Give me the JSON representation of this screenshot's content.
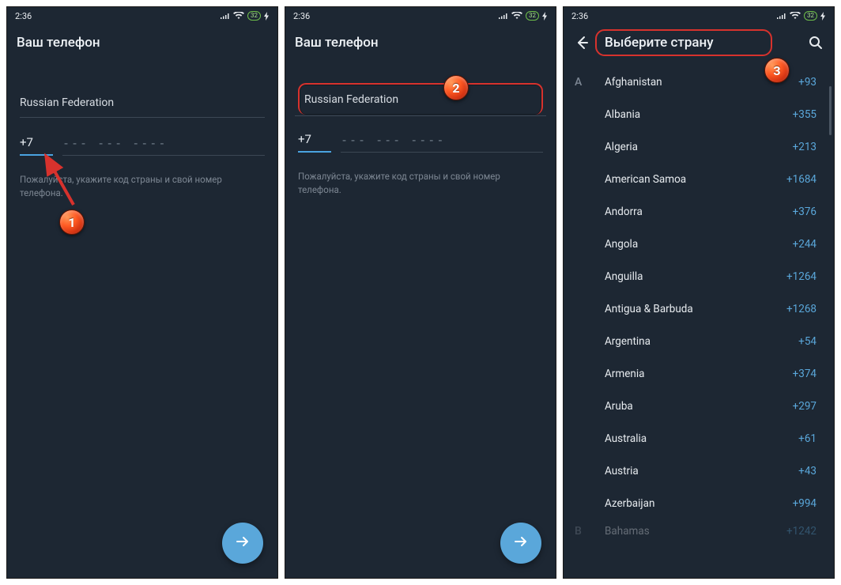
{
  "status": {
    "time": "2:36",
    "battery": "32"
  },
  "screen1": {
    "title": "Ваш телефон",
    "country": "Russian Federation",
    "code": "+7",
    "placeholder": "--- --- ----",
    "hint": "Пожалуйста, укажите код страны и свой номер телефона.",
    "badge": "1"
  },
  "screen2": {
    "title": "Ваш телефон",
    "country": "Russian Federation",
    "code": "+7",
    "placeholder": "--- --- ----",
    "hint": "Пожалуйста, укажите код страны и свой номер телефона.",
    "badge": "2"
  },
  "screen3": {
    "title": "Выберите страну",
    "badge": "3",
    "section": "A",
    "countries": [
      {
        "name": "Afghanistan",
        "code": "+93"
      },
      {
        "name": "Albania",
        "code": "+355"
      },
      {
        "name": "Algeria",
        "code": "+213"
      },
      {
        "name": "American Samoa",
        "code": "+1684"
      },
      {
        "name": "Andorra",
        "code": "+376"
      },
      {
        "name": "Angola",
        "code": "+244"
      },
      {
        "name": "Anguilla",
        "code": "+1264"
      },
      {
        "name": "Antigua & Barbuda",
        "code": "+1268"
      },
      {
        "name": "Argentina",
        "code": "+54"
      },
      {
        "name": "Armenia",
        "code": "+374"
      },
      {
        "name": "Aruba",
        "code": "+297"
      },
      {
        "name": "Australia",
        "code": "+61"
      },
      {
        "name": "Austria",
        "code": "+43"
      },
      {
        "name": "Azerbaijan",
        "code": "+994"
      }
    ],
    "next_section": "B",
    "next_country": {
      "name": "Bahamas",
      "code": "+1242"
    }
  }
}
